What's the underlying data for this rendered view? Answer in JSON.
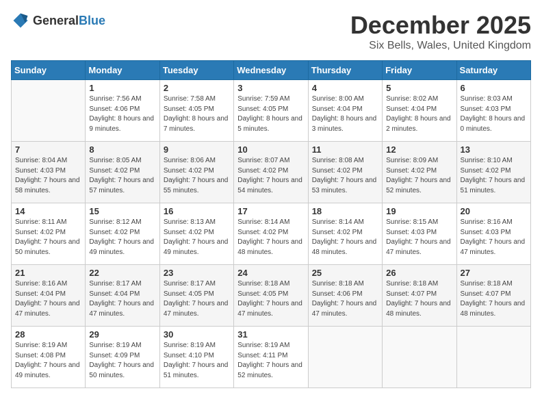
{
  "logo": {
    "text_general": "General",
    "text_blue": "Blue"
  },
  "title": "December 2025",
  "location": "Six Bells, Wales, United Kingdom",
  "days_of_week": [
    "Sunday",
    "Monday",
    "Tuesday",
    "Wednesday",
    "Thursday",
    "Friday",
    "Saturday"
  ],
  "weeks": [
    [
      {
        "day": "",
        "sunrise": "",
        "sunset": "",
        "daylight": ""
      },
      {
        "day": "1",
        "sunrise": "Sunrise: 7:56 AM",
        "sunset": "Sunset: 4:06 PM",
        "daylight": "Daylight: 8 hours and 9 minutes."
      },
      {
        "day": "2",
        "sunrise": "Sunrise: 7:58 AM",
        "sunset": "Sunset: 4:05 PM",
        "daylight": "Daylight: 8 hours and 7 minutes."
      },
      {
        "day": "3",
        "sunrise": "Sunrise: 7:59 AM",
        "sunset": "Sunset: 4:05 PM",
        "daylight": "Daylight: 8 hours and 5 minutes."
      },
      {
        "day": "4",
        "sunrise": "Sunrise: 8:00 AM",
        "sunset": "Sunset: 4:04 PM",
        "daylight": "Daylight: 8 hours and 3 minutes."
      },
      {
        "day": "5",
        "sunrise": "Sunrise: 8:02 AM",
        "sunset": "Sunset: 4:04 PM",
        "daylight": "Daylight: 8 hours and 2 minutes."
      },
      {
        "day": "6",
        "sunrise": "Sunrise: 8:03 AM",
        "sunset": "Sunset: 4:03 PM",
        "daylight": "Daylight: 8 hours and 0 minutes."
      }
    ],
    [
      {
        "day": "7",
        "sunrise": "Sunrise: 8:04 AM",
        "sunset": "Sunset: 4:03 PM",
        "daylight": "Daylight: 7 hours and 58 minutes."
      },
      {
        "day": "8",
        "sunrise": "Sunrise: 8:05 AM",
        "sunset": "Sunset: 4:02 PM",
        "daylight": "Daylight: 7 hours and 57 minutes."
      },
      {
        "day": "9",
        "sunrise": "Sunrise: 8:06 AM",
        "sunset": "Sunset: 4:02 PM",
        "daylight": "Daylight: 7 hours and 55 minutes."
      },
      {
        "day": "10",
        "sunrise": "Sunrise: 8:07 AM",
        "sunset": "Sunset: 4:02 PM",
        "daylight": "Daylight: 7 hours and 54 minutes."
      },
      {
        "day": "11",
        "sunrise": "Sunrise: 8:08 AM",
        "sunset": "Sunset: 4:02 PM",
        "daylight": "Daylight: 7 hours and 53 minutes."
      },
      {
        "day": "12",
        "sunrise": "Sunrise: 8:09 AM",
        "sunset": "Sunset: 4:02 PM",
        "daylight": "Daylight: 7 hours and 52 minutes."
      },
      {
        "day": "13",
        "sunrise": "Sunrise: 8:10 AM",
        "sunset": "Sunset: 4:02 PM",
        "daylight": "Daylight: 7 hours and 51 minutes."
      }
    ],
    [
      {
        "day": "14",
        "sunrise": "Sunrise: 8:11 AM",
        "sunset": "Sunset: 4:02 PM",
        "daylight": "Daylight: 7 hours and 50 minutes."
      },
      {
        "day": "15",
        "sunrise": "Sunrise: 8:12 AM",
        "sunset": "Sunset: 4:02 PM",
        "daylight": "Daylight: 7 hours and 49 minutes."
      },
      {
        "day": "16",
        "sunrise": "Sunrise: 8:13 AM",
        "sunset": "Sunset: 4:02 PM",
        "daylight": "Daylight: 7 hours and 49 minutes."
      },
      {
        "day": "17",
        "sunrise": "Sunrise: 8:14 AM",
        "sunset": "Sunset: 4:02 PM",
        "daylight": "Daylight: 7 hours and 48 minutes."
      },
      {
        "day": "18",
        "sunrise": "Sunrise: 8:14 AM",
        "sunset": "Sunset: 4:02 PM",
        "daylight": "Daylight: 7 hours and 48 minutes."
      },
      {
        "day": "19",
        "sunrise": "Sunrise: 8:15 AM",
        "sunset": "Sunset: 4:03 PM",
        "daylight": "Daylight: 7 hours and 47 minutes."
      },
      {
        "day": "20",
        "sunrise": "Sunrise: 8:16 AM",
        "sunset": "Sunset: 4:03 PM",
        "daylight": "Daylight: 7 hours and 47 minutes."
      }
    ],
    [
      {
        "day": "21",
        "sunrise": "Sunrise: 8:16 AM",
        "sunset": "Sunset: 4:04 PM",
        "daylight": "Daylight: 7 hours and 47 minutes."
      },
      {
        "day": "22",
        "sunrise": "Sunrise: 8:17 AM",
        "sunset": "Sunset: 4:04 PM",
        "daylight": "Daylight: 7 hours and 47 minutes."
      },
      {
        "day": "23",
        "sunrise": "Sunrise: 8:17 AM",
        "sunset": "Sunset: 4:05 PM",
        "daylight": "Daylight: 7 hours and 47 minutes."
      },
      {
        "day": "24",
        "sunrise": "Sunrise: 8:18 AM",
        "sunset": "Sunset: 4:05 PM",
        "daylight": "Daylight: 7 hours and 47 minutes."
      },
      {
        "day": "25",
        "sunrise": "Sunrise: 8:18 AM",
        "sunset": "Sunset: 4:06 PM",
        "daylight": "Daylight: 7 hours and 47 minutes."
      },
      {
        "day": "26",
        "sunrise": "Sunrise: 8:18 AM",
        "sunset": "Sunset: 4:07 PM",
        "daylight": "Daylight: 7 hours and 48 minutes."
      },
      {
        "day": "27",
        "sunrise": "Sunrise: 8:18 AM",
        "sunset": "Sunset: 4:07 PM",
        "daylight": "Daylight: 7 hours and 48 minutes."
      }
    ],
    [
      {
        "day": "28",
        "sunrise": "Sunrise: 8:19 AM",
        "sunset": "Sunset: 4:08 PM",
        "daylight": "Daylight: 7 hours and 49 minutes."
      },
      {
        "day": "29",
        "sunrise": "Sunrise: 8:19 AM",
        "sunset": "Sunset: 4:09 PM",
        "daylight": "Daylight: 7 hours and 50 minutes."
      },
      {
        "day": "30",
        "sunrise": "Sunrise: 8:19 AM",
        "sunset": "Sunset: 4:10 PM",
        "daylight": "Daylight: 7 hours and 51 minutes."
      },
      {
        "day": "31",
        "sunrise": "Sunrise: 8:19 AM",
        "sunset": "Sunset: 4:11 PM",
        "daylight": "Daylight: 7 hours and 52 minutes."
      },
      {
        "day": "",
        "sunrise": "",
        "sunset": "",
        "daylight": ""
      },
      {
        "day": "",
        "sunrise": "",
        "sunset": "",
        "daylight": ""
      },
      {
        "day": "",
        "sunrise": "",
        "sunset": "",
        "daylight": ""
      }
    ]
  ]
}
